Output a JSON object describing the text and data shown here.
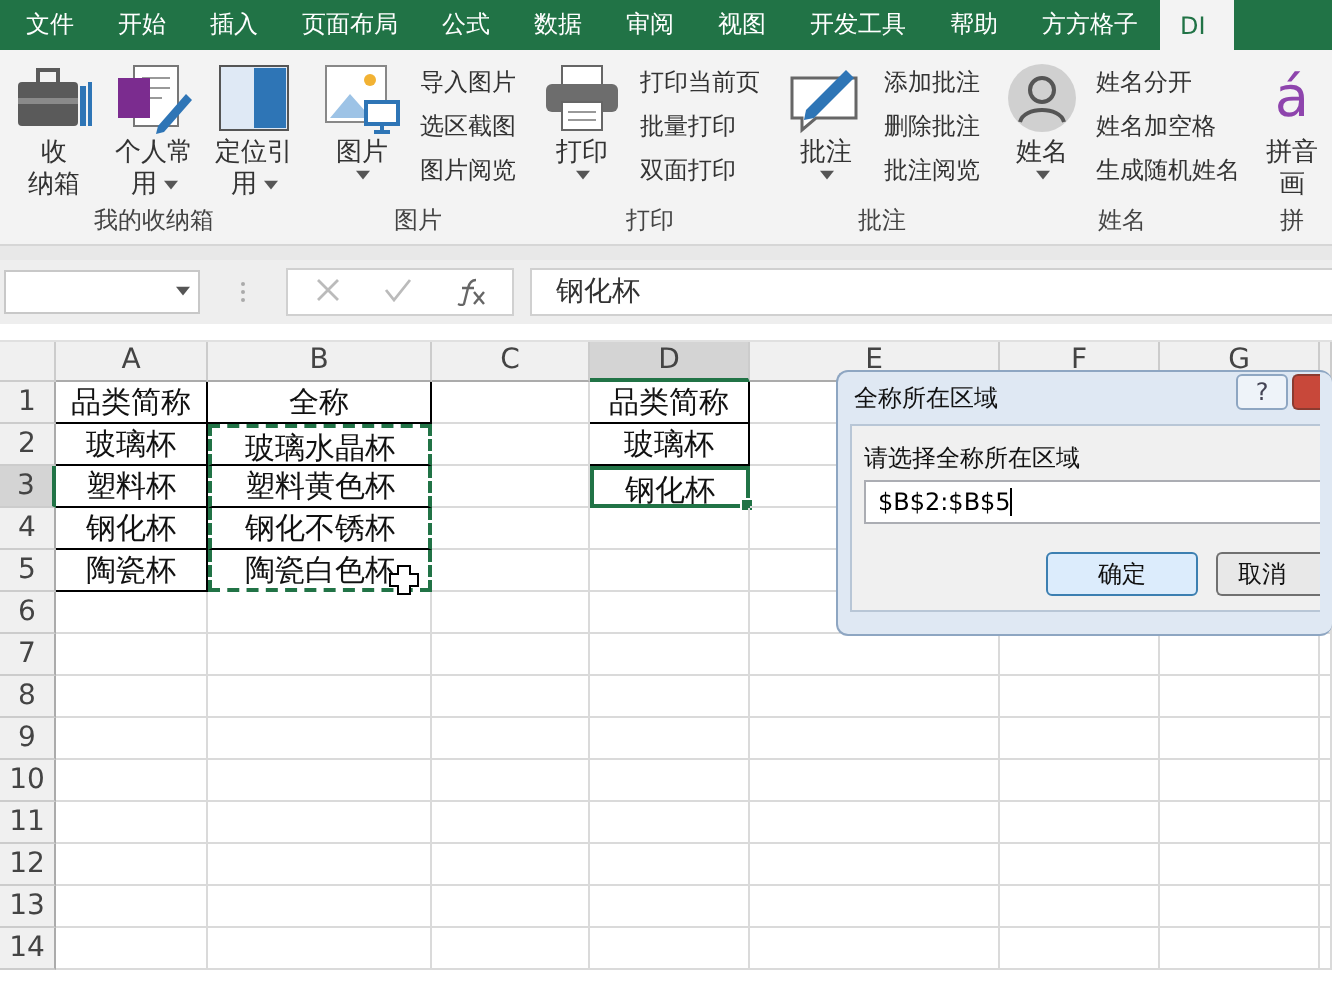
{
  "tabs": [
    {
      "label": "文件",
      "selected": false
    },
    {
      "label": "开始",
      "selected": false
    },
    {
      "label": "插入",
      "selected": false
    },
    {
      "label": "页面布局",
      "selected": false
    },
    {
      "label": "公式",
      "selected": false
    },
    {
      "label": "数据",
      "selected": false
    },
    {
      "label": "审阅",
      "selected": false
    },
    {
      "label": "视图",
      "selected": false
    },
    {
      "label": "开发工具",
      "selected": false
    },
    {
      "label": "帮助",
      "selected": false
    },
    {
      "label": "方方格子",
      "selected": false
    },
    {
      "label": "DI",
      "selected": true
    }
  ],
  "ribbon_groups": [
    {
      "label": "我的收纳箱",
      "large": [
        {
          "lines": [
            "收",
            "纳箱"
          ],
          "dropdown": false
        },
        {
          "lines": [
            "个人常",
            "用"
          ],
          "dropdown": true
        },
        {
          "lines": [
            "定位引",
            "用"
          ],
          "dropdown": true
        }
      ]
    },
    {
      "label": "图片",
      "large": [
        {
          "lines": [
            "图片"
          ],
          "dropdown": true
        }
      ],
      "small": [
        "导入图片",
        "选区截图",
        "图片阅览"
      ]
    },
    {
      "label": "打印",
      "large": [
        {
          "lines": [
            "打印"
          ],
          "dropdown": true
        }
      ],
      "small": [
        "打印当前页",
        "批量打印",
        "双面打印"
      ]
    },
    {
      "label": "批注",
      "large": [
        {
          "lines": [
            "批注"
          ],
          "dropdown": true
        }
      ],
      "small": [
        "添加批注",
        "删除批注",
        "批注阅览"
      ]
    },
    {
      "label": "姓名",
      "large": [
        {
          "lines": [
            "姓名"
          ],
          "dropdown": true
        }
      ],
      "small": [
        "姓名分开",
        "姓名加空格",
        "生成随机姓名"
      ]
    },
    {
      "label": "拼",
      "large": [
        {
          "glyph": "á",
          "lines": [
            "拼音",
            "画"
          ],
          "dropdown": false
        }
      ]
    }
  ],
  "formula_bar": {
    "value": "钢化杯"
  },
  "columns": [
    {
      "label": "A",
      "selected": false
    },
    {
      "label": "B",
      "selected": false
    },
    {
      "label": "C",
      "selected": false
    },
    {
      "label": "D",
      "selected": true
    },
    {
      "label": "E",
      "selected": false
    },
    {
      "label": "F",
      "selected": false
    },
    {
      "label": "G",
      "selected": false
    }
  ],
  "rows": [
    {
      "label": "1",
      "selected": false,
      "a": {
        "text": "品类简称",
        "active": false,
        "marquee": false
      },
      "b": {
        "text": "全称",
        "active": false,
        "marquee": false
      },
      "d": {
        "text": "品类简称",
        "active": false,
        "marquee": false
      }
    },
    {
      "label": "2",
      "selected": false,
      "a": {
        "text": "玻璃杯",
        "active": false,
        "marquee": false
      },
      "b": {
        "text": "玻璃水晶杯",
        "active": false,
        "marquee": true
      },
      "d": {
        "text": "玻璃杯",
        "active": false,
        "marquee": false
      }
    },
    {
      "label": "3",
      "selected": true,
      "a": {
        "text": "塑料杯",
        "active": false,
        "marquee": false
      },
      "b": {
        "text": "塑料黄色杯",
        "active": false,
        "marquee": true
      },
      "d": {
        "text": "钢化杯",
        "active": true,
        "marquee": false
      }
    },
    {
      "label": "4",
      "selected": false,
      "a": {
        "text": "钢化杯",
        "active": false,
        "marquee": false
      },
      "b": {
        "text": "钢化不锈杯",
        "active": false,
        "marquee": true
      }
    },
    {
      "label": "5",
      "selected": false,
      "a": {
        "text": "陶瓷杯",
        "active": false,
        "marquee": false
      },
      "b": {
        "text": "陶瓷白色杯",
        "active": false,
        "marquee": true
      }
    },
    {
      "label": "6",
      "selected": false
    },
    {
      "label": "7",
      "selected": false
    },
    {
      "label": "8",
      "selected": false
    },
    {
      "label": "9",
      "selected": false
    },
    {
      "label": "10",
      "selected": false
    },
    {
      "label": "11",
      "selected": false
    },
    {
      "label": "12",
      "selected": false
    },
    {
      "label": "13",
      "selected": false
    },
    {
      "label": "14",
      "selected": false
    }
  ],
  "dialog": {
    "title": "全称所在区域",
    "help": "?",
    "prompt": "请选择全称所在区域",
    "value": "$B$2:$B$5",
    "buttons": [
      {
        "label": "确定",
        "default": true
      },
      {
        "label": "取消",
        "default": false
      }
    ]
  }
}
